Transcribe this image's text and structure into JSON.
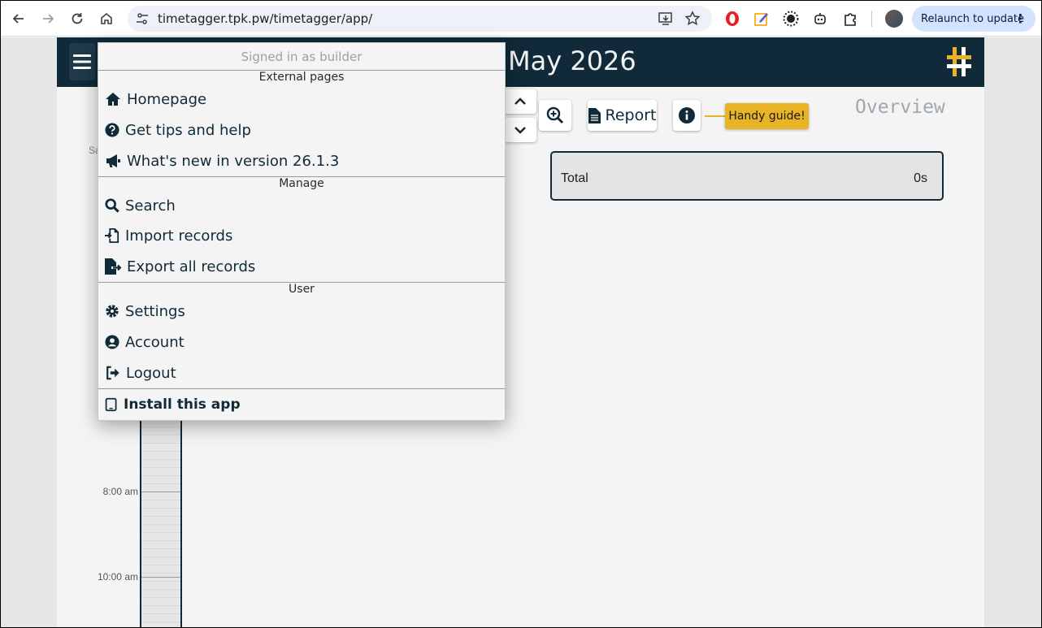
{
  "browser": {
    "url": "timetagger.tpk.pw/timetagger/app/",
    "relaunch_label": "Relaunch to update"
  },
  "app": {
    "header_title": "May 2026",
    "report_label": "Report",
    "guide_label": "Handy guide!",
    "overview_label": "Overview",
    "total": {
      "label": "Total",
      "value": "0s"
    },
    "day_label_partial": "Sa",
    "time_labels": [
      "8:00 am",
      "10:00 am"
    ]
  },
  "menu": {
    "signed_in": "Signed in as builder",
    "sections": {
      "external": "External pages",
      "manage": "Manage",
      "user": "User"
    },
    "items": {
      "homepage": "Homepage",
      "tips": "Get tips and help",
      "whatsnew": "What's new in version 26.1.3",
      "search": "Search",
      "import": "Import records",
      "export": "Export all records",
      "settings": "Settings",
      "account": "Account",
      "logout": "Logout",
      "install": "Install this app"
    }
  },
  "colors": {
    "header_bg": "#102a39",
    "accent_yellow": "#e8b325",
    "page_bg": "#f4f4f4"
  }
}
